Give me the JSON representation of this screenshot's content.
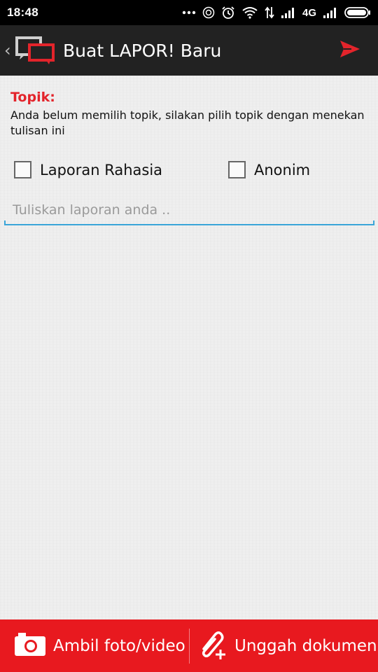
{
  "status_bar": {
    "time": "18:48",
    "network": "4G",
    "icons": [
      "more-dots-icon",
      "hotspot-icon",
      "alarm-icon",
      "wifi-icon",
      "data-arrows-icon",
      "signal-icon",
      "signal-icon",
      "battery-icon"
    ]
  },
  "header": {
    "title": "Buat LAPOR! Baru",
    "back_icon": "chevron-left-icon",
    "logo": "lapor-logo",
    "send_icon": "send-icon"
  },
  "form": {
    "topic_label": "Topik:",
    "topic_hint": "Anda belum memilih topik, silakan pilih topik dengan menekan tulisan ini",
    "secret_label": "Laporan Rahasia",
    "anonymous_label": "Anonim",
    "secret_checked": false,
    "anonymous_checked": false,
    "report_placeholder": "Tuliskan laporan anda .."
  },
  "bottom_bar": {
    "photo_label": "Ambil foto/video",
    "doc_label": "Unggah dokumen",
    "photo_icon": "camera-icon",
    "doc_icon": "paperclip-plus-icon"
  },
  "colors": {
    "accent": "#e8191f",
    "topic_red": "#e3242b",
    "header_bg": "#222222",
    "input_underline": "#3aa5d8"
  }
}
